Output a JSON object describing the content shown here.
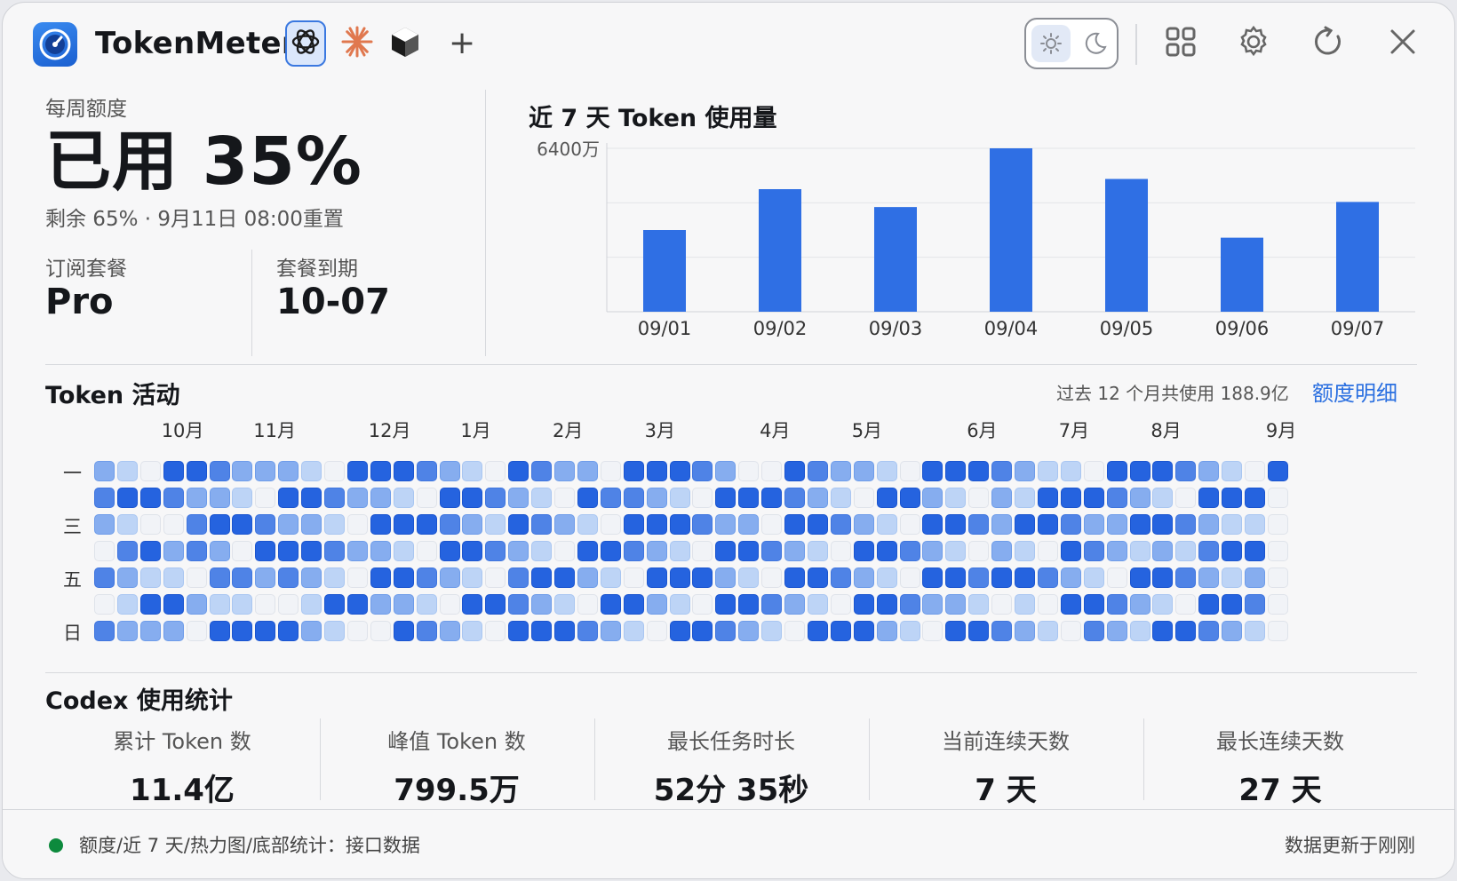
{
  "header": {
    "app_title": "TokenMeter",
    "app_icon": "speedometer-icon",
    "providers": [
      {
        "icon": "openai-icon",
        "active": true
      },
      {
        "icon": "claude-icon",
        "active": false
      },
      {
        "icon": "cube-icon",
        "active": false
      }
    ],
    "add_label": "+",
    "theme": "light",
    "actions": [
      "grid-icon",
      "gear-icon",
      "refresh-icon",
      "close-icon"
    ]
  },
  "quota": {
    "label": "每周额度",
    "used_text": "已用 35%",
    "used_percent": 35,
    "sub_text": "剩余 65% · 9月11日 08:00重置",
    "plan_label": "订阅套餐",
    "plan_value": "Pro",
    "expiry_label": "套餐到期",
    "expiry_value": "10-07"
  },
  "chart_title": "近 7 天 Token 使用量",
  "chart_data": {
    "type": "bar",
    "categories": [
      "09/01",
      "09/02",
      "09/03",
      "09/04",
      "09/05",
      "09/06",
      "09/07"
    ],
    "values": [
      3200,
      4800,
      4100,
      6400,
      5200,
      2900,
      4300
    ],
    "y_tick_label": "6400万",
    "ylim": [
      0,
      6400
    ],
    "unit": "万",
    "grid": true,
    "bar_color": "#2f6fe4"
  },
  "heatmap": {
    "title": "Token 活动",
    "total_text": "过去 12 个月共使用 188.9亿",
    "link_label": "额度明细",
    "months": [
      {
        "label": "10月",
        "col": 3
      },
      {
        "label": "11月",
        "col": 7
      },
      {
        "label": "12月",
        "col": 12
      },
      {
        "label": "1月",
        "col": 16
      },
      {
        "label": "2月",
        "col": 20
      },
      {
        "label": "3月",
        "col": 24
      },
      {
        "label": "4月",
        "col": 29
      },
      {
        "label": "5月",
        "col": 33
      },
      {
        "label": "6月",
        "col": 38
      },
      {
        "label": "7月",
        "col": 42
      },
      {
        "label": "8月",
        "col": 46
      },
      {
        "label": "9月",
        "col": 51
      }
    ],
    "day_labels": [
      {
        "label": "一",
        "row": 0
      },
      {
        "label": "三",
        "row": 2
      },
      {
        "label": "五",
        "row": 4
      },
      {
        "label": "日",
        "row": 6
      }
    ],
    "colors": [
      "#f1f3f7",
      "#bdd4f6",
      "#86adef",
      "#4f83e6",
      "#2563df"
    ],
    "weeks": [
      [
        2,
        3,
        2,
        0,
        3,
        0,
        3
      ],
      [
        1,
        4,
        1,
        3,
        2,
        1,
        2
      ],
      [
        0,
        4,
        0,
        4,
        1,
        4,
        2
      ],
      [
        4,
        3,
        0,
        2,
        1,
        4,
        2
      ],
      [
        4,
        2,
        3,
        3,
        0,
        2,
        0
      ],
      [
        3,
        2,
        4,
        2,
        3,
        1,
        4
      ],
      [
        2,
        1,
        4,
        0,
        3,
        1,
        4
      ],
      [
        2,
        0,
        3,
        4,
        2,
        0,
        4
      ],
      [
        2,
        4,
        2,
        4,
        3,
        0,
        4
      ],
      [
        1,
        4,
        2,
        4,
        2,
        1,
        2
      ],
      [
        0,
        3,
        1,
        3,
        1,
        4,
        1
      ],
      [
        4,
        2,
        0,
        2,
        0,
        4,
        0
      ],
      [
        4,
        2,
        4,
        2,
        4,
        2,
        0
      ],
      [
        4,
        1,
        4,
        1,
        4,
        2,
        4
      ],
      [
        3,
        0,
        4,
        0,
        3,
        1,
        3
      ],
      [
        2,
        4,
        3,
        4,
        2,
        0,
        2
      ],
      [
        1,
        4,
        2,
        4,
        1,
        4,
        1
      ],
      [
        0,
        3,
        1,
        3,
        0,
        4,
        0
      ],
      [
        4,
        2,
        4,
        2,
        3,
        3,
        4
      ],
      [
        3,
        1,
        3,
        1,
        4,
        2,
        4
      ],
      [
        2,
        0,
        2,
        0,
        4,
        1,
        4
      ],
      [
        2,
        4,
        1,
        4,
        2,
        0,
        3
      ],
      [
        0,
        3,
        0,
        4,
        1,
        4,
        2
      ],
      [
        4,
        3,
        4,
        3,
        0,
        4,
        1
      ],
      [
        4,
        2,
        4,
        2,
        4,
        2,
        0
      ],
      [
        4,
        1,
        4,
        1,
        4,
        1,
        4
      ],
      [
        3,
        0,
        3,
        0,
        4,
        0,
        4
      ],
      [
        2,
        4,
        2,
        4,
        2,
        4,
        3
      ],
      [
        0,
        4,
        2,
        4,
        1,
        4,
        2
      ],
      [
        0,
        4,
        0,
        3,
        0,
        3,
        1
      ],
      [
        4,
        3,
        4,
        2,
        4,
        2,
        0
      ],
      [
        3,
        2,
        4,
        1,
        4,
        1,
        4
      ],
      [
        2,
        1,
        3,
        0,
        3,
        0,
        4
      ],
      [
        2,
        0,
        2,
        4,
        2,
        4,
        4
      ],
      [
        1,
        4,
        1,
        4,
        1,
        4,
        2
      ],
      [
        0,
        4,
        0,
        3,
        0,
        3,
        1
      ],
      [
        4,
        2,
        4,
        2,
        4,
        2,
        0
      ],
      [
        4,
        1,
        4,
        1,
        4,
        2,
        4
      ],
      [
        4,
        0,
        3,
        0,
        3,
        1,
        4
      ],
      [
        3,
        2,
        2,
        2,
        4,
        0,
        3
      ],
      [
        2,
        1,
        4,
        1,
        4,
        1,
        2
      ],
      [
        1,
        4,
        4,
        0,
        3,
        0,
        1
      ],
      [
        1,
        4,
        3,
        4,
        2,
        4,
        0
      ],
      [
        0,
        4,
        2,
        3,
        1,
        4,
        3
      ],
      [
        4,
        3,
        2,
        2,
        0,
        3,
        2
      ],
      [
        4,
        2,
        4,
        1,
        4,
        2,
        1
      ],
      [
        4,
        1,
        4,
        2,
        4,
        1,
        4
      ],
      [
        3,
        0,
        3,
        1,
        3,
        0,
        4
      ],
      [
        2,
        4,
        2,
        3,
        2,
        4,
        3
      ],
      [
        1,
        4,
        1,
        4,
        1,
        4,
        2
      ],
      [
        0,
        4,
        1,
        4,
        2,
        3,
        1
      ],
      [
        4,
        0,
        0,
        0,
        0,
        0,
        0
      ]
    ]
  },
  "stats": {
    "title": "Codex 使用统计",
    "items": [
      {
        "label": "累计 Token 数",
        "value": "11.4亿"
      },
      {
        "label": "峰值 Token 数",
        "value": "799.5万"
      },
      {
        "label": "最长任务时长",
        "value": "52分 35秒"
      },
      {
        "label": "当前连续天数",
        "value": "7 天"
      },
      {
        "label": "最长连续天数",
        "value": "27 天"
      }
    ]
  },
  "footer": {
    "status_color": "#0d8a3d",
    "left_text": "额度/近 7 天/热力图/底部统计：接口数据",
    "right_text": "数据更新于刚刚"
  }
}
